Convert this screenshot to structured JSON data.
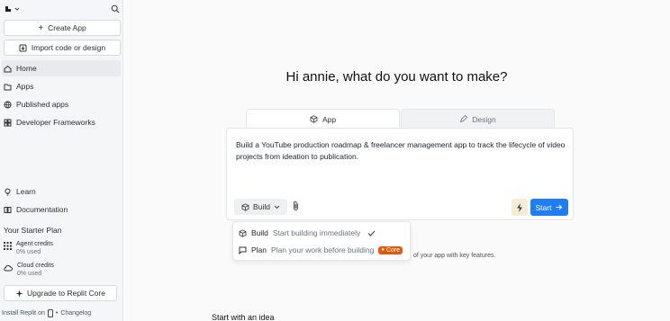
{
  "sidebar": {
    "create_app": "Create App",
    "import_code": "Import code or design",
    "nav": [
      {
        "label": "Home",
        "icon": "home-icon"
      },
      {
        "label": "Apps",
        "icon": "folder-icon"
      },
      {
        "label": "Published apps",
        "icon": "globe-icon"
      },
      {
        "label": "Developer Frameworks",
        "icon": "frameworks-icon"
      }
    ],
    "learn": "Learn",
    "documentation": "Documentation",
    "plan_title": "Your Starter Plan",
    "agent_credits": "Agent credits",
    "agent_used": "0% used",
    "cloud_credits": "Cloud credits",
    "cloud_used": "0% used",
    "upgrade": "Upgrade to Replit Core",
    "footer_install": "Install Replit on",
    "footer_sep": "•",
    "footer_changelog": "Changelog"
  },
  "main": {
    "greeting": "Hi annie, what do you want to make?",
    "tab_app": "App",
    "tab_design": "Design",
    "prompt": "Build a YouTube production roadmap & freelancer management app to track the lifecycle of video projects from ideation to publication.",
    "build_label": "Build",
    "start_label": "Start",
    "dropdown": {
      "build_title": "Build",
      "build_desc": "Start building immediately",
      "plan_title": "Plan",
      "plan_desc": "Plan your work before building",
      "core_badge": "Core"
    },
    "hint": "of your app with key features.",
    "section_title": "Start with an idea"
  },
  "colors": {
    "accent": "#1f7ef4",
    "core_badge": "#e25a0c"
  }
}
